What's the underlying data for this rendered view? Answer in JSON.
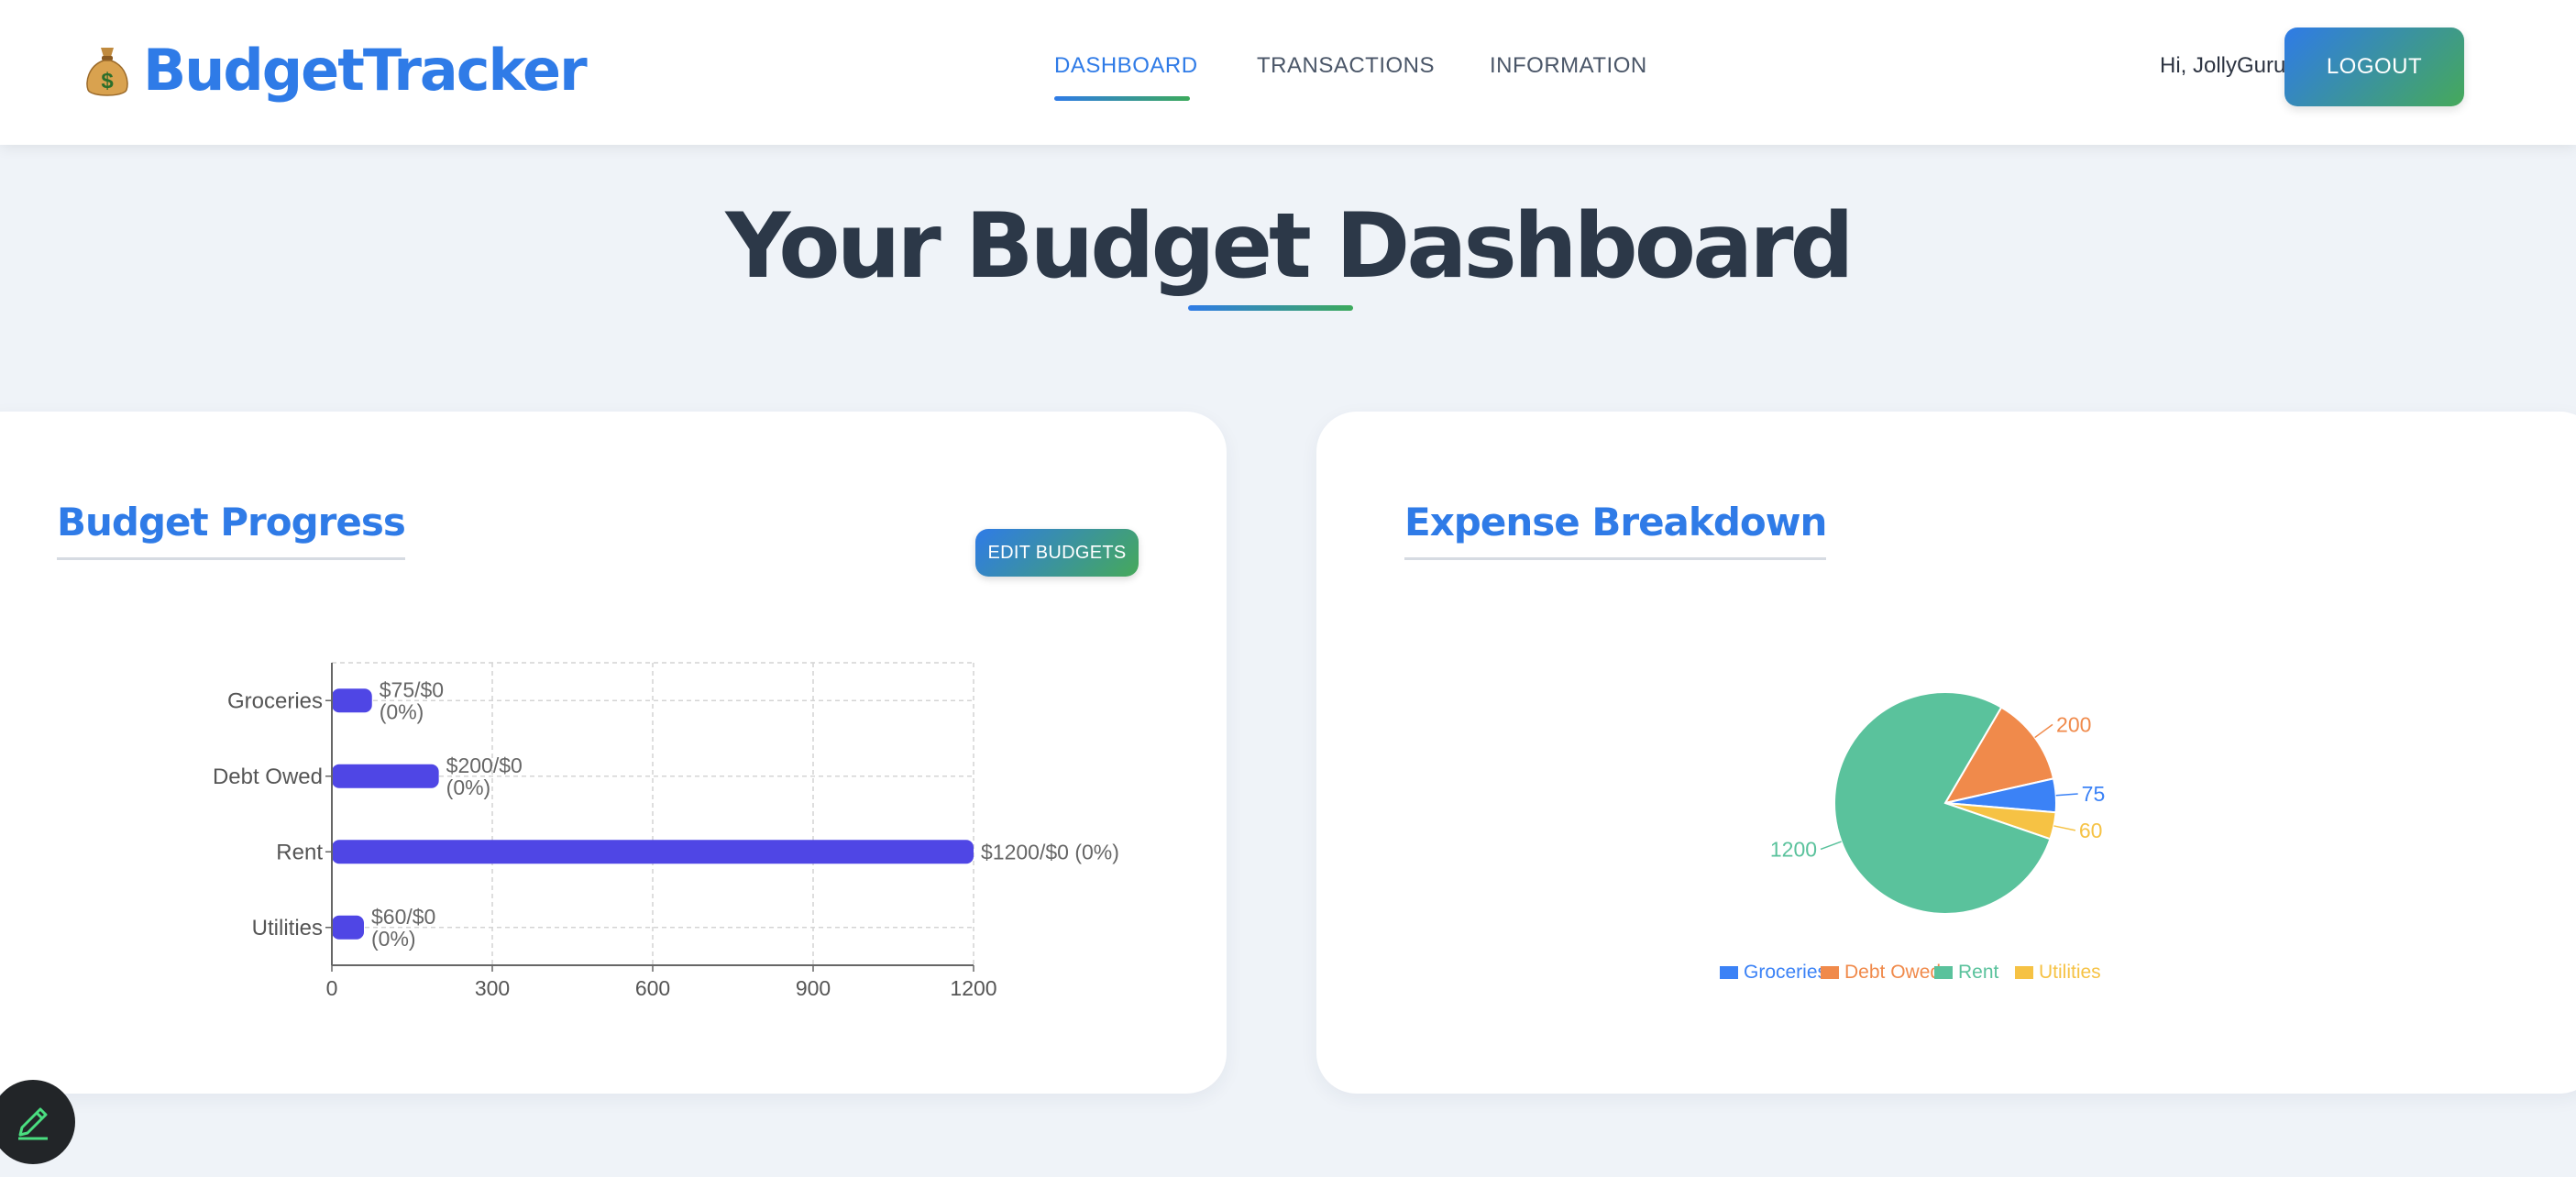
{
  "header": {
    "brand": "BudgetTracker",
    "brand_icon": "money-bag-icon",
    "nav": [
      {
        "label": "DASHBOARD",
        "active": true
      },
      {
        "label": "TRANSACTIONS",
        "active": false
      },
      {
        "label": "INFORMATION",
        "active": false
      }
    ],
    "greeting": "Hi, JollyGuru",
    "logout_label": "LOGOUT"
  },
  "page": {
    "title": "Your Budget Dashboard"
  },
  "budget_card": {
    "title": "Budget Progress",
    "edit_label": "EDIT BUDGETS"
  },
  "expense_card": {
    "title": "Expense Breakdown"
  },
  "colors": {
    "accent": "#2f7be7",
    "bar": "#4f46e5",
    "groceries": "#3b82f6",
    "debt": "#f08a4b",
    "rent": "#5ac29c",
    "utilities": "#f6c244"
  },
  "fab_icon": "pencil-icon",
  "chart_data": [
    {
      "type": "bar",
      "orientation": "horizontal",
      "categories": [
        "Groceries",
        "Debt Owed",
        "Rent",
        "Utilities"
      ],
      "values": [
        75,
        200,
        1200,
        60
      ],
      "data_labels": [
        "$75/$0 (0%)",
        "$200/$0 (0%)",
        "$1200/$0 (0%)",
        "$60/$0 (0%)"
      ],
      "xticks": [
        0,
        300,
        600,
        900,
        1200
      ],
      "xlim": [
        0,
        1200
      ],
      "grid": true
    },
    {
      "type": "pie",
      "labels": [
        "Groceries",
        "Debt Owed",
        "Rent",
        "Utilities"
      ],
      "values": [
        75,
        200,
        1200,
        60
      ],
      "legend": "bottom"
    }
  ]
}
